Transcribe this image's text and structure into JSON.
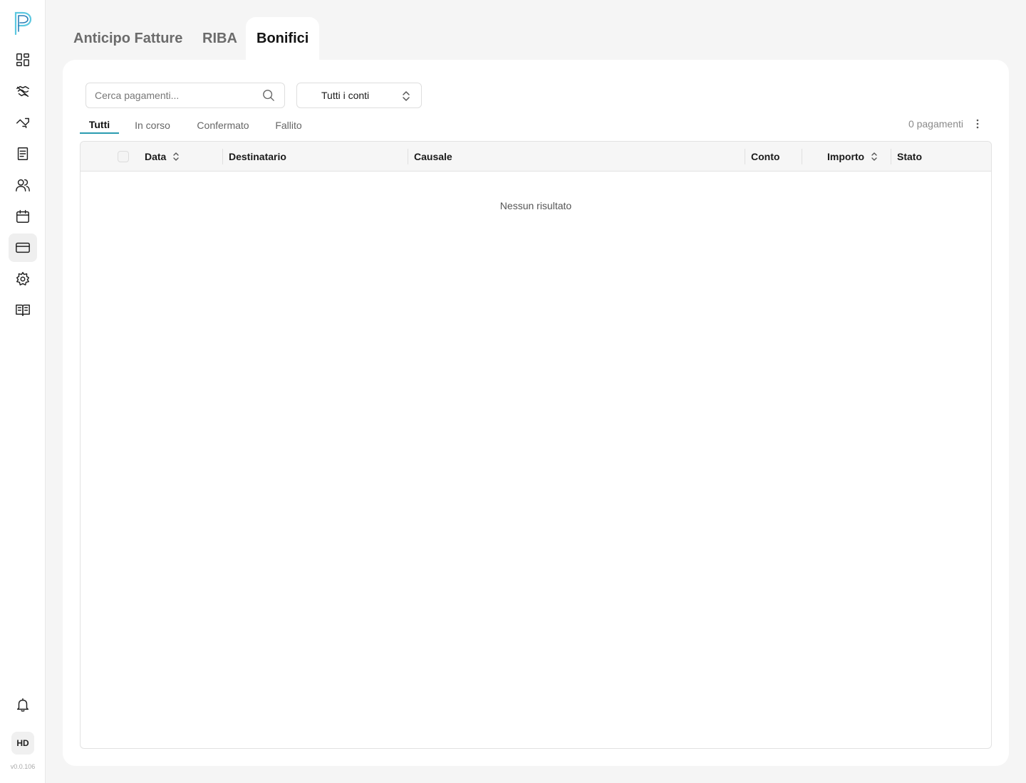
{
  "sidebar": {
    "logo": "p-logo",
    "items": [
      {
        "name": "dashboard-icon"
      },
      {
        "name": "handshake-icon"
      },
      {
        "name": "trend-icon"
      },
      {
        "name": "document-icon"
      },
      {
        "name": "users-icon"
      },
      {
        "name": "calendar-icon"
      },
      {
        "name": "credit-card-icon",
        "active": true
      },
      {
        "name": "gear-icon"
      },
      {
        "name": "book-icon"
      }
    ],
    "notifications": "bell-icon",
    "avatar_initials": "HD",
    "version": "v0.0.106"
  },
  "top_tabs": [
    {
      "label": "Anticipo Fatture"
    },
    {
      "label": "RIBA"
    },
    {
      "label": "Bonifici",
      "active": true
    }
  ],
  "toolbar": {
    "search_placeholder": "Cerca pagamenti...",
    "account_select": "Tutti i conti"
  },
  "filter_tabs": [
    {
      "label": "Tutti",
      "active": true
    },
    {
      "label": "In corso"
    },
    {
      "label": "Confermato"
    },
    {
      "label": "Fallito"
    }
  ],
  "payment_count": "0 pagamenti",
  "table": {
    "columns": [
      "Data",
      "Destinatario",
      "Causale",
      "Conto",
      "Importo",
      "Stato"
    ],
    "rows": [],
    "empty_message": "Nessun risultato"
  },
  "colors": {
    "accent": "#2a9bb0",
    "background": "#f5f5f5",
    "card": "#ffffff"
  }
}
